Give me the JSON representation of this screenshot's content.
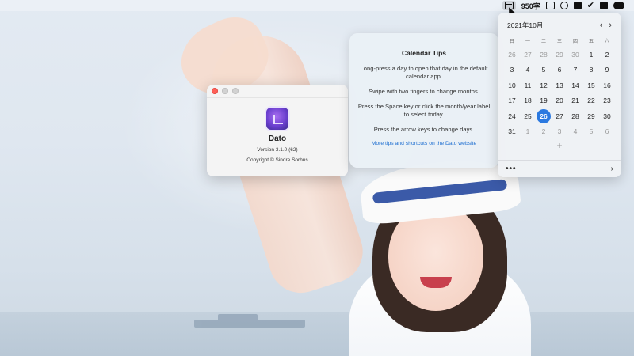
{
  "menubar": {
    "counter_text": "950字",
    "icons": [
      "calendar-icon",
      "screen-icon",
      "clock-icon",
      "grid-icon",
      "bird-icon",
      "shield-icon",
      "wechat-icon"
    ]
  },
  "about": {
    "app_name": "Dato",
    "version": "Version 3.1.0 (62)",
    "copyright": "Copyright © Sindre Sorhus"
  },
  "tips": {
    "title": "Calendar Tips",
    "lines": [
      "Long-press a day to open that day in the default calendar app.",
      "Swipe with two fingers to change months.",
      "Press the Space key or click the month/year label to select today.",
      "Press the arrow keys to change days."
    ],
    "link": "More tips and shortcuts on the Dato website"
  },
  "calendar": {
    "month_label": "2021年10月",
    "prev": "‹",
    "next": "›",
    "weekdays": [
      "日",
      "一",
      "二",
      "三",
      "四",
      "五",
      "六"
    ],
    "weeks": [
      [
        [
          "26",
          true
        ],
        [
          "27",
          true
        ],
        [
          "28",
          true
        ],
        [
          "29",
          true
        ],
        [
          "30",
          true
        ],
        [
          "1",
          false
        ],
        [
          "2",
          false
        ]
      ],
      [
        [
          "3",
          false
        ],
        [
          "4",
          false
        ],
        [
          "5",
          false
        ],
        [
          "6",
          false
        ],
        [
          "7",
          false
        ],
        [
          "8",
          false
        ],
        [
          "9",
          false
        ]
      ],
      [
        [
          "10",
          false
        ],
        [
          "11",
          false
        ],
        [
          "12",
          false
        ],
        [
          "13",
          false
        ],
        [
          "14",
          false
        ],
        [
          "15",
          false
        ],
        [
          "16",
          false
        ]
      ],
      [
        [
          "17",
          false
        ],
        [
          "18",
          false
        ],
        [
          "19",
          false
        ],
        [
          "20",
          false
        ],
        [
          "21",
          false
        ],
        [
          "22",
          false
        ],
        [
          "23",
          false
        ]
      ],
      [
        [
          "24",
          false
        ],
        [
          "25",
          false
        ],
        [
          "26",
          false
        ],
        [
          "27",
          false
        ],
        [
          "28",
          false
        ],
        [
          "29",
          false
        ],
        [
          "30",
          false
        ]
      ],
      [
        [
          "31",
          false
        ],
        [
          "1",
          true
        ],
        [
          "2",
          true
        ],
        [
          "3",
          true
        ],
        [
          "4",
          true
        ],
        [
          "5",
          true
        ],
        [
          "6",
          true
        ]
      ]
    ],
    "today": "26",
    "add_label": "+",
    "more_label": "•••",
    "footer_arrow": "›"
  },
  "colors": {
    "accent": "#2b79e0",
    "close_light": "#ff5f57",
    "link": "#1f6fd1"
  }
}
